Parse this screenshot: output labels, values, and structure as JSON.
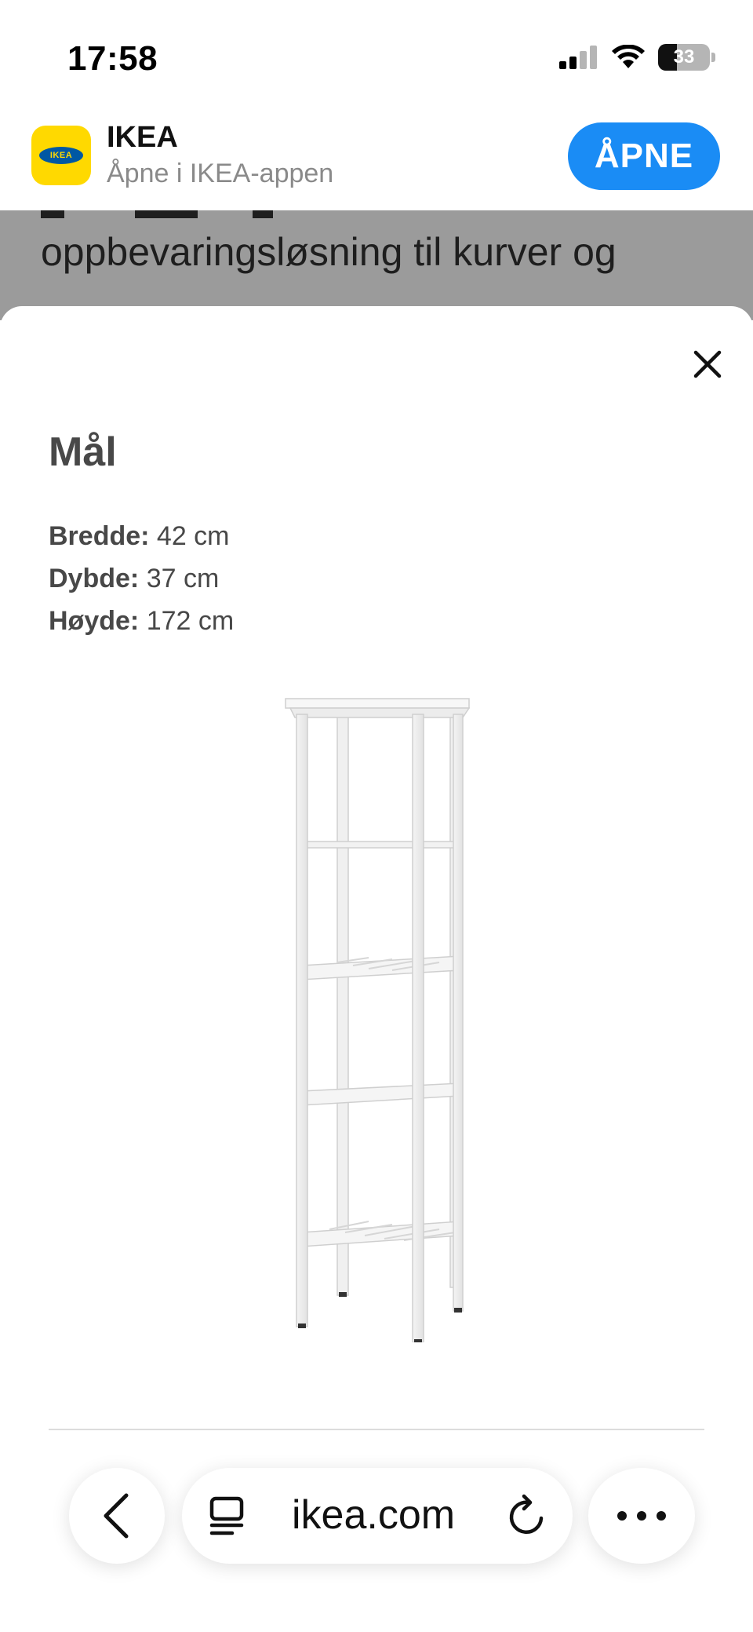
{
  "status_bar": {
    "time": "17:58",
    "battery": "33",
    "icons": [
      "signal-icon",
      "wifi-icon",
      "battery-icon"
    ]
  },
  "app_banner": {
    "app_name": "IKEA",
    "subtitle": "Åpne i IKEA-appen",
    "open_button": "ÅPNE",
    "logo_text": "IKEA"
  },
  "background_page": {
    "visible_text": "oppbevaringsløsning til kurver og"
  },
  "dimensions_sheet": {
    "title": "Mål",
    "rows": [
      {
        "label": "Bredde:",
        "value": "42 cm"
      },
      {
        "label": "Dybde:",
        "value": "37 cm"
      },
      {
        "label": "Høyde:",
        "value": "172 cm"
      }
    ],
    "close_icon": "close-icon"
  },
  "browser": {
    "url": "ikea.com",
    "icons": [
      "back-arrow-icon",
      "reader-icon",
      "reload-icon",
      "more-icon"
    ]
  },
  "colors": {
    "accent": "#1a8cf5",
    "ikea_yellow": "#ffd900",
    "ikea_blue": "#0058a3",
    "backdrop": "#9b9b9b"
  }
}
